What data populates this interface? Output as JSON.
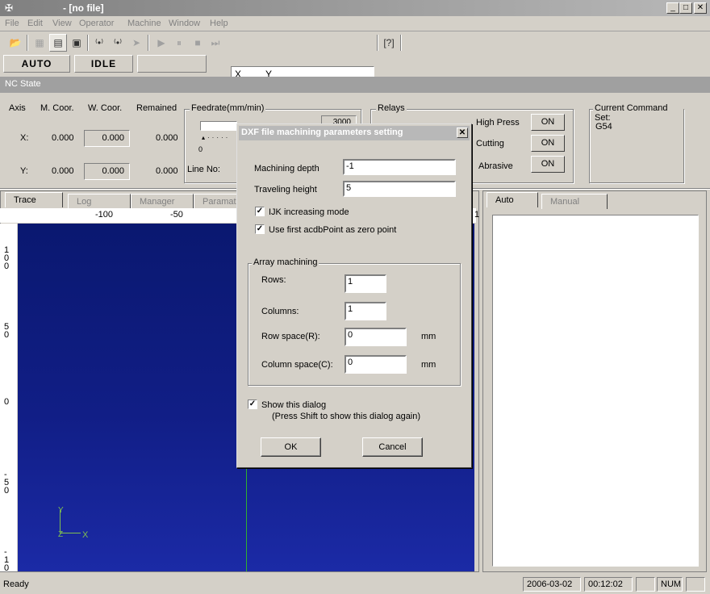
{
  "window": {
    "title": "- [no file]"
  },
  "menu": [
    "File",
    "Edit",
    "View",
    "Operator",
    "Machine",
    "Window",
    "Help"
  ],
  "toolbar": {
    "coord_x": "X",
    "coord_y": "Y"
  },
  "status_panels": {
    "mode": "AUTO",
    "state": "IDLE"
  },
  "nc_state": {
    "title": "NC State",
    "headers": {
      "axis": "Axis",
      "m_coor": "M. Coor.",
      "w_coor": "W. Coor.",
      "remained": "Remained"
    },
    "rows": [
      {
        "axis": "X:",
        "m": "0.000",
        "w": "0.000",
        "r": "0.000"
      },
      {
        "axis": "Y:",
        "m": "0.000",
        "w": "0.000",
        "r": "0.000"
      }
    ],
    "feedrate_label": "Feedrate(mm/min)",
    "feedrate_value": "3000",
    "slider_min": "0",
    "line_no_label": "Line No:",
    "relays_label": "Relays",
    "relays": [
      {
        "name": "High Press",
        "state": "ON"
      },
      {
        "name": "Cutting",
        "state": "ON"
      },
      {
        "name": "Abrasive",
        "state": "ON"
      }
    ],
    "command_set_label": "Current Command Set:",
    "command_set_value": "G54"
  },
  "left_tabs": [
    "Trace",
    "Log",
    "Manager",
    "Paramat"
  ],
  "right_tabs": [
    "Auto",
    "Manual"
  ],
  "ruler": {
    "top": [
      "-100",
      "-50",
      "1"
    ],
    "left": [
      "1\n0\n0",
      "5\n0",
      "0",
      "-\n5\n0",
      "-\n1\n0"
    ]
  },
  "axis_indicator": {
    "y": "Y",
    "z": "Z",
    "x": "X"
  },
  "dialog": {
    "title": "DXF file machining parameters setting",
    "machining_depth_label": "Machining depth",
    "machining_depth_value": "-1",
    "traveling_height_label": "Traveling height",
    "traveling_height_value": "5",
    "ijk_label": "IJK increasing mode",
    "ijk_checked": true,
    "first_point_label": "Use first acdbPoint as zero point",
    "first_point_checked": true,
    "array_label": "Array machining",
    "rows_label": "Rows:",
    "rows_value": "1",
    "columns_label": "Columns:",
    "columns_value": "1",
    "row_space_label": "Row space(R):",
    "row_space_value": "0",
    "column_space_label": "Column space(C):",
    "column_space_value": "0",
    "unit": "mm",
    "show_dialog_label": "Show this dialog",
    "show_dialog_checked": true,
    "show_dialog_hint": "(Press Shift to show this dialog again)",
    "ok_label": "OK",
    "cancel_label": "Cancel"
  },
  "statusbar": {
    "ready": "Ready",
    "date": "2006-03-02",
    "time": "00:12:02",
    "num": "NUM"
  }
}
